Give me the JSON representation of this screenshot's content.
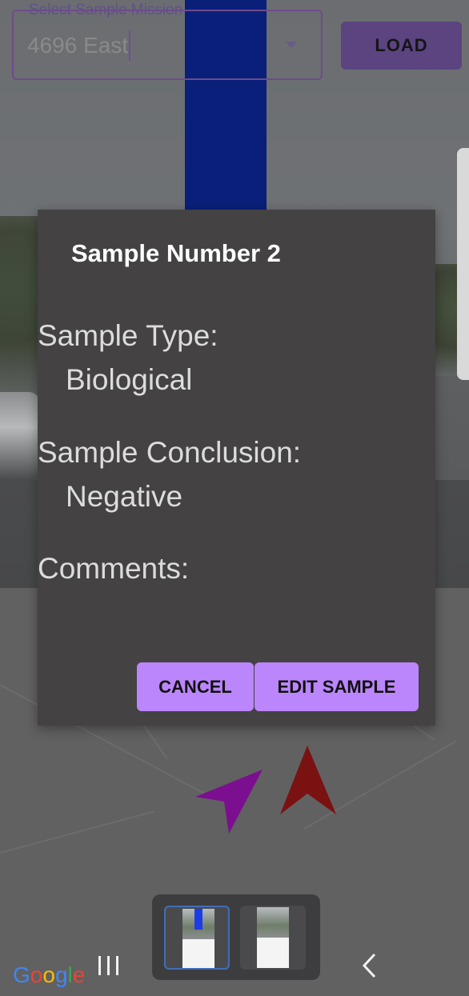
{
  "mission_select": {
    "label": "Select Sample Mission",
    "value": "4696 East"
  },
  "load_button_label": "LOAD",
  "dialog": {
    "title": "Sample Number 2",
    "sample_type_label": "Sample Type:",
    "sample_type_value": "Biological",
    "sample_conclusion_label": "Sample Conclusion:",
    "sample_conclusion_value": "Negative",
    "comments_label": "Comments:",
    "comments_value": "",
    "cancel_label": "CANCEL",
    "edit_label": "EDIT SAMPLE"
  },
  "map": {
    "user_marker_color": "#7b0f8f",
    "heading_marker_color": "#7a1212"
  },
  "path_color": "#0a1f7a",
  "accent_color": "#bb86fc",
  "bottom_nav": {
    "google_logo": "Google",
    "recents_icon": "recents-icon",
    "back_icon": "back-chevron-icon"
  }
}
